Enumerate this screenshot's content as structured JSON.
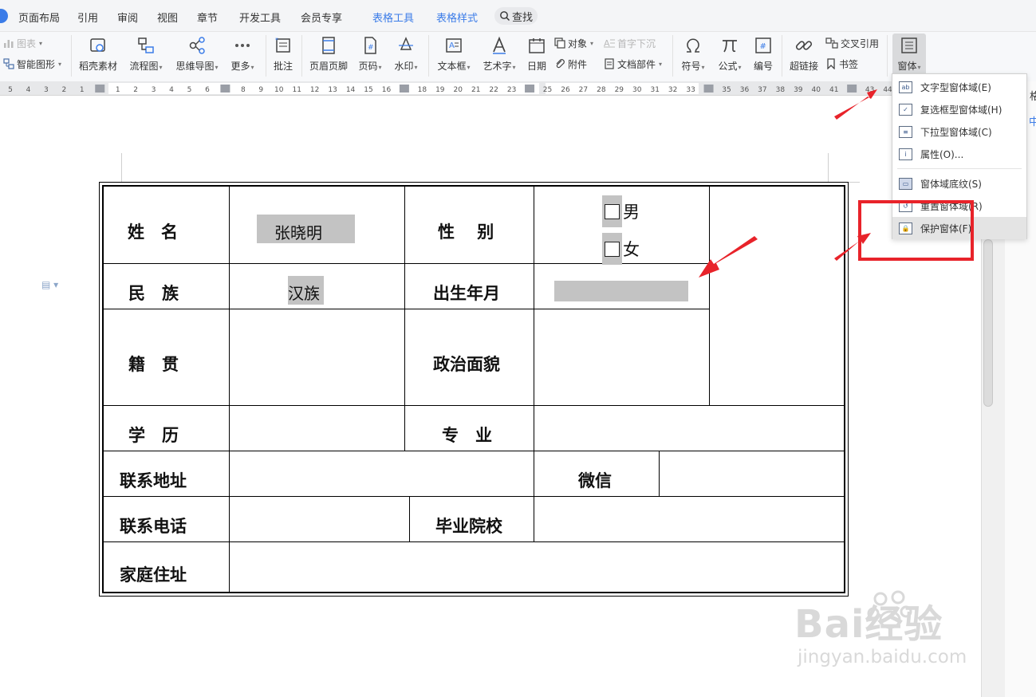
{
  "tabs": [
    {
      "label": "页面布局"
    },
    {
      "label": "引用"
    },
    {
      "label": "审阅"
    },
    {
      "label": "视图"
    },
    {
      "label": "章节"
    },
    {
      "label": "开发工具"
    },
    {
      "label": "会员专享"
    },
    {
      "label": "表格工具"
    },
    {
      "label": "表格样式"
    }
  ],
  "search": {
    "label": "查找"
  },
  "ribbon": {
    "chart": "图表",
    "smartart": "智能图形",
    "daoke": "稻壳素材",
    "flowchart": "流程图",
    "mindmap": "思维导图",
    "more": "更多",
    "comment": "批注",
    "header_footer": "页眉页脚",
    "page_number": "页码",
    "watermark": "水印",
    "textbox": "文本框",
    "wordart": "艺术字",
    "date": "日期",
    "object": "对象",
    "attachment": "附件",
    "dropcap": "首字下沉",
    "docpart": "文档部件",
    "symbol": "符号",
    "formula": "公式",
    "numbering": "编号",
    "hyperlink": "超链接",
    "crossref": "交叉引用",
    "bookmark": "书签",
    "form": "窗体"
  },
  "ruler": {
    "numbers": [
      "5",
      "4",
      "3",
      "2",
      "1",
      "",
      "1",
      "2",
      "3",
      "4",
      "5",
      "6",
      "",
      "8",
      "9",
      "10",
      "11",
      "12",
      "13",
      "14",
      "15",
      "16",
      "",
      "18",
      "19",
      "20",
      "21",
      "22",
      "23",
      "",
      "25",
      "26",
      "27",
      "28",
      "29",
      "30",
      "31",
      "32",
      "33",
      "",
      "35",
      "36",
      "37",
      "38",
      "39",
      "40",
      "41",
      "",
      "43",
      "44"
    ]
  },
  "form_menu": {
    "items": [
      {
        "label": "文字型窗体域(E)",
        "icon": "ab"
      },
      {
        "label": "复选框型窗体域(H)",
        "icon": "✓"
      },
      {
        "label": "下拉型窗体域(C)",
        "icon": "≡"
      },
      {
        "label": "属性(O)...",
        "icon": "i"
      },
      {
        "label": "窗体域底纹(S)",
        "icon": "▭"
      },
      {
        "label": "重置窗体域(R)",
        "icon": "↺"
      },
      {
        "label": "保护窗体(F)",
        "icon": "🔒"
      }
    ]
  },
  "side_panel": {
    "text1": "格",
    "text2": "中"
  },
  "form": {
    "name_label": "姓　名",
    "name_value": "张晓明",
    "gender_label": "性　 别",
    "gender_male": "男",
    "gender_female": "女",
    "ethnicity_label": "民　族",
    "ethnicity_value": "汉族",
    "birth_label": "出生年月",
    "native_label": "籍　贯",
    "political_label": "政治面貌",
    "education_label": "学　历",
    "major_label": "专　业",
    "address_label": "联系地址",
    "wechat_label": "微信",
    "phone_label": "联系电话",
    "school_label": "毕业院校",
    "home_label": "家庭住址"
  },
  "watermark": {
    "brand": "Bai经验",
    "url": "jingyan.baidu.com"
  },
  "colors": {
    "accent": "#3b7ce8",
    "annotation": "#e8232a",
    "field_shade": "#c3c3c3"
  }
}
